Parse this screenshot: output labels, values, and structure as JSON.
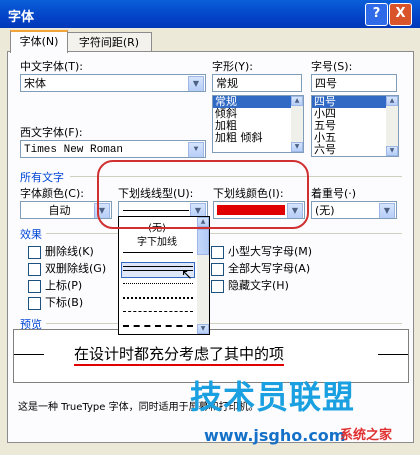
{
  "window": {
    "title": "字体",
    "help_glyph": "?",
    "close_glyph": "X"
  },
  "tabs": [
    {
      "label": "字体(N)"
    },
    {
      "label": "字符间距(R)"
    }
  ],
  "chinese_font": {
    "label": "中文字体(T):",
    "value": "宋体"
  },
  "western_font": {
    "label": "西文字体(F):",
    "value": "Times New Roman"
  },
  "font_style": {
    "label": "字形(Y):",
    "value": "常规",
    "options": [
      "常规",
      "倾斜",
      "加粗",
      "加粗 倾斜"
    ],
    "selected": 0
  },
  "font_size": {
    "label": "字号(S):",
    "value": "四号",
    "options": [
      "四号",
      "小四",
      "五号",
      "小五",
      "六号"
    ],
    "selected": 0
  },
  "all_text": {
    "group_label": "所有文字",
    "font_color": {
      "label": "字体颜色(C):",
      "value": "自动"
    },
    "underline_type": {
      "label": "下划线线型(U):"
    },
    "underline_color": {
      "label": "下划线颜色(I):",
      "color": "#E00000"
    },
    "emphasis": {
      "label": "着重号(·)",
      "value": "(无)"
    }
  },
  "underline_list": {
    "none_label": "(无)",
    "word_label": "字下加线"
  },
  "effects": {
    "group_label": "效果",
    "left": [
      "删除线(K)",
      "双删除线(G)",
      "上标(P)",
      "下标(B)"
    ],
    "right": [
      "小型大写字母(M)",
      "全部大写字母(A)",
      "隐藏文字(H)"
    ]
  },
  "preview": {
    "label": "预览",
    "sample": "在设计时都充分考虑了其中的项",
    "note": "这是一种 TrueType 字体，同时适用于屏幕和打印机。"
  },
  "watermark": {
    "brand": "技术员联盟",
    "url": "www.jsgho.com",
    "tag": "系统之家",
    "colors": {
      "brand": "#1AA0E0",
      "url": "#1570C8",
      "tag": "#E03030"
    }
  },
  "colors": {
    "accent": "#0046D5",
    "titlebar": "#0A5FD8",
    "highlight": "#316AC5",
    "annotation": "#D03030"
  }
}
